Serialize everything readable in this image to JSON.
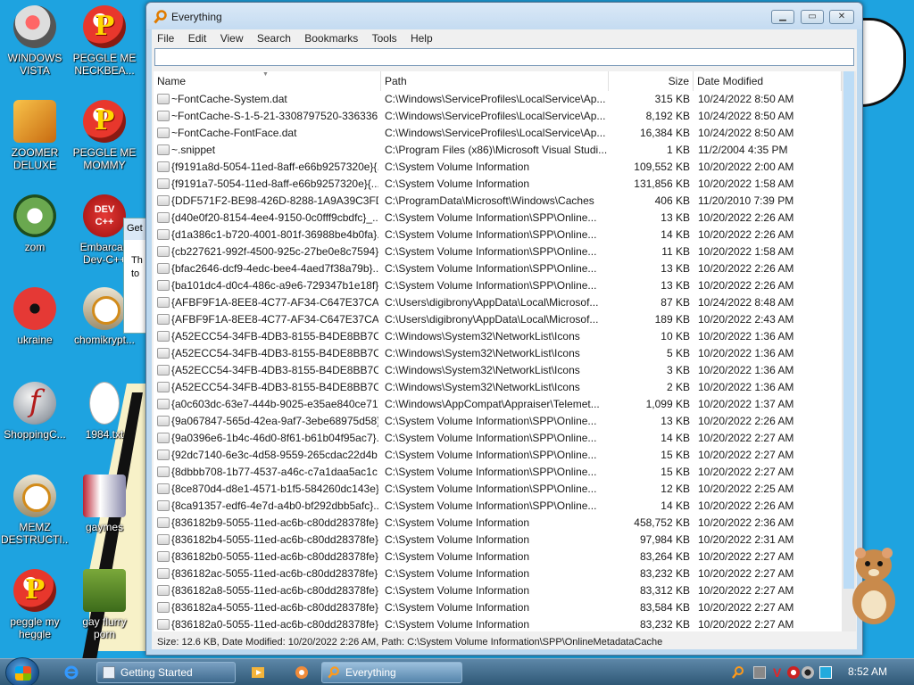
{
  "desktop": {
    "icons": [
      {
        "label": "WINDOWS\nVISTA"
      },
      {
        "label": "PEGGLE ME\nNECKBEA..."
      },
      {
        "label": "ZOOMER\nDELUXE"
      },
      {
        "label": "PEGGLE ME\nMOMMY"
      },
      {
        "label": "zom"
      },
      {
        "label": "Embarcad\nDev-C++"
      },
      {
        "label": "ukraine"
      },
      {
        "label": "chomikrypt..."
      },
      {
        "label": "ShoppingC..."
      },
      {
        "label": "1984.txt"
      },
      {
        "label": "MEMZ\nDESTRUCTI..."
      },
      {
        "label": "gaymes"
      },
      {
        "label": "peggle my\nheggle"
      },
      {
        "label": "gay flurry\nporn"
      }
    ],
    "bg_window": {
      "title": "Get",
      "text": "Th\nto"
    }
  },
  "window": {
    "title": "Everything",
    "menu": [
      "File",
      "Edit",
      "View",
      "Search",
      "Bookmarks",
      "Tools",
      "Help"
    ],
    "search": {
      "value": "",
      "placeholder": ""
    },
    "columns": {
      "name": "Name",
      "path": "Path",
      "size": "Size",
      "date": "Date Modified"
    },
    "rows": [
      {
        "name": "~FontCache-System.dat",
        "path": "C:\\Windows\\ServiceProfiles\\LocalService\\Ap...",
        "size": "315 KB",
        "date": "10/24/2022 8:50 AM"
      },
      {
        "name": "~FontCache-S-1-5-21-3308797520-336336...",
        "path": "C:\\Windows\\ServiceProfiles\\LocalService\\Ap...",
        "size": "8,192 KB",
        "date": "10/24/2022 8:50 AM"
      },
      {
        "name": "~FontCache-FontFace.dat",
        "path": "C:\\Windows\\ServiceProfiles\\LocalService\\Ap...",
        "size": "16,384 KB",
        "date": "10/24/2022 8:50 AM"
      },
      {
        "name": "~.snippet",
        "path": "C:\\Program Files (x86)\\Microsoft Visual Studi...",
        "size": "1 KB",
        "date": "11/2/2004 4:35 PM"
      },
      {
        "name": "{f9191a8d-5054-11ed-8aff-e66b9257320e}{...",
        "path": "C:\\System Volume Information",
        "size": "109,552 KB",
        "date": "10/20/2022 2:00 AM"
      },
      {
        "name": "{f9191a7-5054-11ed-8aff-e66b9257320e}{...",
        "path": "C:\\System Volume Information",
        "size": "131,856 KB",
        "date": "10/20/2022 1:58 AM"
      },
      {
        "name": "{DDF571F2-BE98-426D-8288-1A9A39C3FD...",
        "path": "C:\\ProgramData\\Microsoft\\Windows\\Caches",
        "size": "406 KB",
        "date": "11/20/2010 7:39 PM"
      },
      {
        "name": "{d40e0f20-8154-4ee4-9150-0c0fff9cbdfc}_...",
        "path": "C:\\System Volume Information\\SPP\\Online...",
        "size": "13 KB",
        "date": "10/20/2022 2:26 AM"
      },
      {
        "name": "{d1a386c1-b720-4001-801f-36988be4b0fa}...",
        "path": "C:\\System Volume Information\\SPP\\Online...",
        "size": "14 KB",
        "date": "10/20/2022 2:26 AM"
      },
      {
        "name": "{cb227621-992f-4500-925c-27be0e8c7594}...",
        "path": "C:\\System Volume Information\\SPP\\Online...",
        "size": "11 KB",
        "date": "10/20/2022 1:58 AM"
      },
      {
        "name": "{bfac2646-dcf9-4edc-bee4-4aed7f38a79b}...",
        "path": "C:\\System Volume Information\\SPP\\Online...",
        "size": "13 KB",
        "date": "10/20/2022 2:26 AM"
      },
      {
        "name": "{ba101dc4-d0c4-486c-a9e6-729347b1e18f}...",
        "path": "C:\\System Volume Information\\SPP\\Online...",
        "size": "13 KB",
        "date": "10/20/2022 2:26 AM"
      },
      {
        "name": "{AFBF9F1A-8EE8-4C77-AF34-C647E37CA0...",
        "path": "C:\\Users\\digibrony\\AppData\\Local\\Microsof...",
        "size": "87 KB",
        "date": "10/24/2022 8:48 AM"
      },
      {
        "name": "{AFBF9F1A-8EE8-4C77-AF34-C647E37CA0...",
        "path": "C:\\Users\\digibrony\\AppData\\Local\\Microsof...",
        "size": "189 KB",
        "date": "10/20/2022 2:43 AM"
      },
      {
        "name": "{A52ECC54-34FB-4DB3-8155-B4DE8BB7CD...",
        "path": "C:\\Windows\\System32\\NetworkList\\Icons",
        "size": "10 KB",
        "date": "10/20/2022 1:36 AM"
      },
      {
        "name": "{A52ECC54-34FB-4DB3-8155-B4DE8BB7CD...",
        "path": "C:\\Windows\\System32\\NetworkList\\Icons",
        "size": "5 KB",
        "date": "10/20/2022 1:36 AM"
      },
      {
        "name": "{A52ECC54-34FB-4DB3-8155-B4DE8BB7CD...",
        "path": "C:\\Windows\\System32\\NetworkList\\Icons",
        "size": "3 KB",
        "date": "10/20/2022 1:36 AM"
      },
      {
        "name": "{A52ECC54-34FB-4DB3-8155-B4DE8BB7CD...",
        "path": "C:\\Windows\\System32\\NetworkList\\Icons",
        "size": "2 KB",
        "date": "10/20/2022 1:36 AM"
      },
      {
        "name": "{a0c603dc-63e7-444b-9025-e35ae840ce71}...",
        "path": "C:\\Windows\\AppCompat\\Appraiser\\Telemet...",
        "size": "1,099 KB",
        "date": "10/20/2022 1:37 AM"
      },
      {
        "name": "{9a067847-565d-42ea-9af7-3ebe68975d58}...",
        "path": "C:\\System Volume Information\\SPP\\Online...",
        "size": "13 KB",
        "date": "10/20/2022 2:26 AM"
      },
      {
        "name": "{9a0396e6-1b4c-46d0-8f61-b61b04f95ac7}...",
        "path": "C:\\System Volume Information\\SPP\\Online...",
        "size": "14 KB",
        "date": "10/20/2022 2:27 AM"
      },
      {
        "name": "{92dc7140-6e3c-4d58-9559-265cdac22d4b...",
        "path": "C:\\System Volume Information\\SPP\\Online...",
        "size": "15 KB",
        "date": "10/20/2022 2:27 AM"
      },
      {
        "name": "{8dbbb708-1b77-4537-a46c-c7a1daa5ac1c...",
        "path": "C:\\System Volume Information\\SPP\\Online...",
        "size": "15 KB",
        "date": "10/20/2022 2:27 AM"
      },
      {
        "name": "{8ce870d4-d8e1-4571-b1f5-584260dc143e}...",
        "path": "C:\\System Volume Information\\SPP\\Online...",
        "size": "12 KB",
        "date": "10/20/2022 2:25 AM"
      },
      {
        "name": "{8ca91357-edf6-4e7d-a4b0-bf292dbb5afc}...",
        "path": "C:\\System Volume Information\\SPP\\Online...",
        "size": "14 KB",
        "date": "10/20/2022 2:26 AM"
      },
      {
        "name": "{836182b9-5055-11ed-ac6b-c80dd28378fe}...",
        "path": "C:\\System Volume Information",
        "size": "458,752 KB",
        "date": "10/20/2022 2:36 AM"
      },
      {
        "name": "{836182b4-5055-11ed-ac6b-c80dd28378fe}...",
        "path": "C:\\System Volume Information",
        "size": "97,984 KB",
        "date": "10/20/2022 2:31 AM"
      },
      {
        "name": "{836182b0-5055-11ed-ac6b-c80dd28378fe}...",
        "path": "C:\\System Volume Information",
        "size": "83,264 KB",
        "date": "10/20/2022 2:27 AM"
      },
      {
        "name": "{836182ac-5055-11ed-ac6b-c80dd28378fe}...",
        "path": "C:\\System Volume Information",
        "size": "83,232 KB",
        "date": "10/20/2022 2:27 AM"
      },
      {
        "name": "{836182a8-5055-11ed-ac6b-c80dd28378fe}...",
        "path": "C:\\System Volume Information",
        "size": "83,312 KB",
        "date": "10/20/2022 2:27 AM"
      },
      {
        "name": "{836182a4-5055-11ed-ac6b-c80dd28378fe}...",
        "path": "C:\\System Volume Information",
        "size": "83,584 KB",
        "date": "10/20/2022 2:27 AM"
      },
      {
        "name": "{836182a0-5055-11ed-ac6b-c80dd28378fe}...",
        "path": "C:\\System Volume Information",
        "size": "83,232 KB",
        "date": "10/20/2022 2:27 AM"
      }
    ],
    "status": "Size: 12.6 KB, Date Modified: 10/20/2022 2:26 AM, Path: C:\\System Volume Information\\SPP\\OnlineMetadataCache"
  },
  "taskbar": {
    "buttons": [
      {
        "label": "Getting Started"
      },
      {
        "label": "Everything"
      }
    ],
    "clock": "8:52 AM"
  },
  "colors": {
    "desktop": "#1ea3e0",
    "accent": "#bcd8ef",
    "selection": "#bcdcf6"
  }
}
